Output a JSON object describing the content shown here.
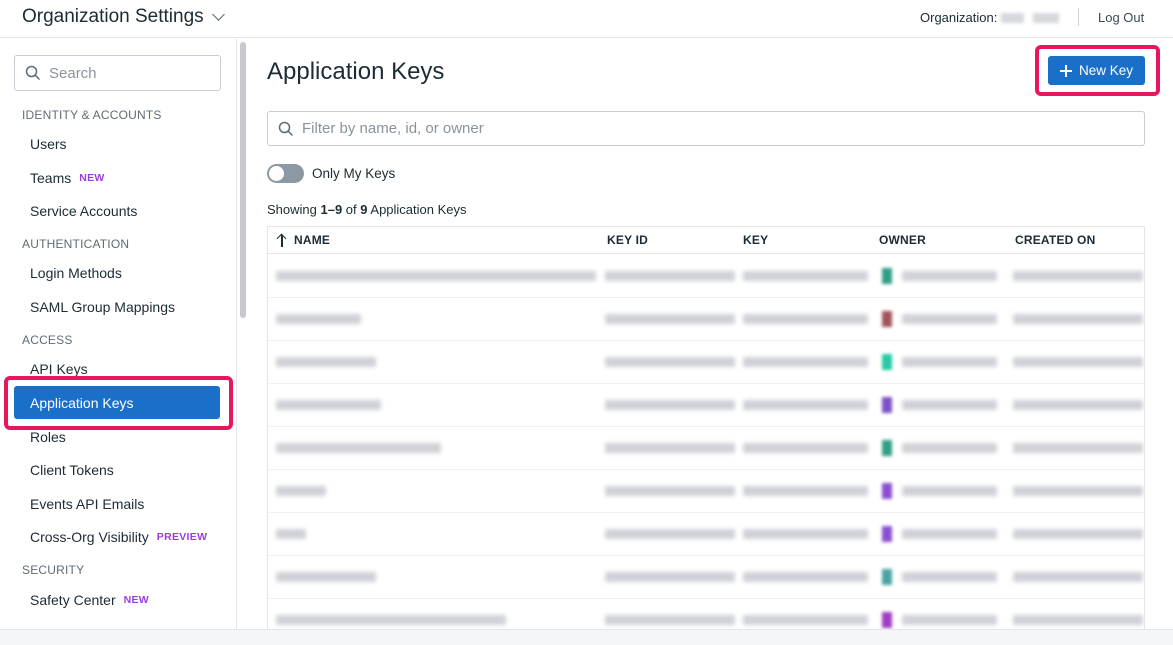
{
  "header": {
    "title": "Organization Settings",
    "org_label": "Organization:",
    "logout_label": "Log Out"
  },
  "sidebar": {
    "search_placeholder": "Search",
    "sections": {
      "identity": "IDENTITY & ACCOUNTS",
      "authentication": "AUTHENTICATION",
      "access": "ACCESS",
      "security": "SECURITY"
    },
    "items": {
      "users": "Users",
      "teams": "Teams",
      "teams_badge": "NEW",
      "service_accounts": "Service Accounts",
      "login_methods": "Login Methods",
      "saml": "SAML Group Mappings",
      "api_keys": "API Keys",
      "application_keys": "Application Keys",
      "roles": "Roles",
      "client_tokens": "Client Tokens",
      "events_api_emails": "Events API Emails",
      "cross_org": "Cross-Org Visibility",
      "cross_org_badge": "PREVIEW",
      "safety_center": "Safety Center",
      "safety_center_badge": "NEW"
    }
  },
  "main": {
    "title": "Application Keys",
    "new_key_label": "New Key",
    "filter_placeholder": "Filter by name, id, or owner",
    "toggle_label": "Only My Keys",
    "toggle_on": false,
    "showing": {
      "prefix": "Showing ",
      "range": "1–9",
      "of": " of ",
      "total": "9",
      "suffix": " Application Keys"
    },
    "table": {
      "columns": [
        "NAME",
        "KEY ID",
        "KEY",
        "OWNER",
        "CREATED ON"
      ],
      "row_count": 9,
      "owner_colors": [
        "#2f9e84",
        "#a0545a",
        "#25c9a4",
        "#7b52c4",
        "#2f9e84",
        "#8a4fd0",
        "#8a4fd0",
        "#4aa3a3",
        "#a03cc4"
      ]
    }
  },
  "colors": {
    "accent": "#1a6fc9",
    "highlight": "#e8175d",
    "badge": "#9a3ee0"
  }
}
